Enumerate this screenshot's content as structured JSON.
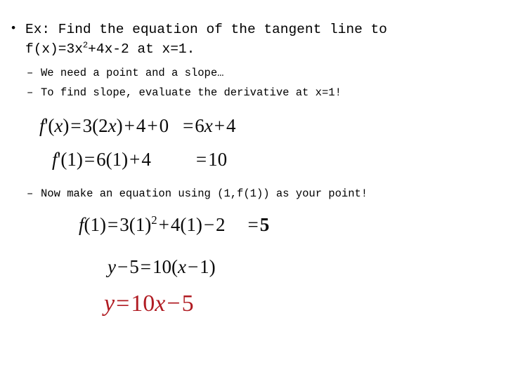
{
  "slide": {
    "background_color": "#ffffff",
    "text_color": "#000000",
    "accent_color": "#b01b22"
  },
  "outline": {
    "main_bullet": {
      "marker": "•",
      "line1": "Ex: Find the equation of the tangent line to",
      "line2_pre": "f(x)=3x",
      "line2_sup": "2",
      "line2_post": "+4x-2 at x=1."
    },
    "sub_bullets": [
      {
        "marker": "–",
        "text": "We need a point and a slope…"
      },
      {
        "marker": "–",
        "text": "To find slope, evaluate the derivative at x=1!"
      },
      {
        "marker": "–",
        "text_before": "Now make an equation using ",
        "text_point": "(1,f(1))",
        "text_after": " as your point!"
      }
    ]
  },
  "equations": {
    "derivative_general": {
      "lhs_f": "f",
      "lhs_prime": "'",
      "lhs_open": "(",
      "lhs_var": "x",
      "lhs_close": ")",
      "eq1": "=",
      "t1": "3(2",
      "t1_var": "x",
      "t1_close": ")",
      "plus1": "+",
      "t2": "4",
      "plus2": "+",
      "t3": "0",
      "eq2": "=",
      "r1": "6",
      "r1_var": "x",
      "plus3": "+",
      "r2": "4"
    },
    "derivative_at_1": {
      "lhs_f": "f",
      "lhs_prime": "'",
      "lhs_arg": "(1)",
      "eq1": "=",
      "t1": "6(1)",
      "plus1": "+",
      "t2": "4",
      "eq2": "=",
      "result": "10"
    },
    "function_at_1": {
      "lhs_f": "f",
      "lhs_arg": "(1)",
      "eq1": "=",
      "t1": "3(1)",
      "t1_sup": "2",
      "plus1": "+",
      "t2": "4(1)",
      "minus1": "−",
      "t3": "2",
      "eq2": "=",
      "result": "5"
    },
    "point_slope": {
      "var_y": "y",
      "minus1": "−",
      "n5": "5",
      "eq1": "=",
      "n10": "10(",
      "var_x": "x",
      "minus2": "−",
      "n1": "1)"
    },
    "final_line": {
      "var_y": "y",
      "eq1": "=",
      "n10": "10",
      "var_x": "x",
      "minus1": "−",
      "n5": "5"
    }
  }
}
